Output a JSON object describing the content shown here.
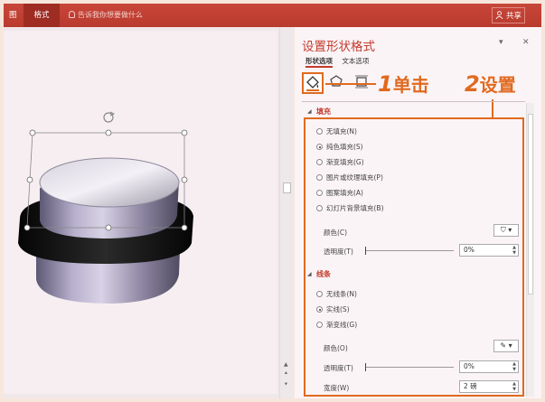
{
  "ribbon": {
    "tab_left": "图",
    "tab_active": "格式",
    "tell_me": "告诉我你想要做什么",
    "share": "共享"
  },
  "pane": {
    "title": "设置形状格式",
    "ctl_dropdown": "▾",
    "ctl_close": "✕",
    "tabs": [
      "形状选项",
      "文本选项"
    ],
    "fill": {
      "header": "填充",
      "options": [
        "无填充(N)",
        "纯色填充(S)",
        "渐变填充(G)",
        "图片或纹理填充(P)",
        "图案填充(A)",
        "幻灯片背景填充(B)"
      ],
      "selected": 1,
      "color_label": "颜色(C)",
      "transparency_label": "透明度(T)",
      "transparency_value": "0%"
    },
    "line": {
      "header": "线条",
      "options": [
        "无线条(N)",
        "实线(S)",
        "渐变线(G)"
      ],
      "selected": 1,
      "color_label": "颜色(O)",
      "transparency_label": "透明度(T)",
      "transparency_value": "0%",
      "width_label": "宽度(W)",
      "width_value": "2 磅"
    }
  },
  "callouts": {
    "one_num": "1",
    "one_text": "单击",
    "two_num": "2",
    "two_text": "设置"
  },
  "colors": {
    "ribbon": "#b93a2e",
    "accent": "#c23b2c",
    "callout": "#e06a1f"
  },
  "icons": [
    "fill-line-icon",
    "effects-icon",
    "size-properties-icon",
    "rotate-handle-icon",
    "bulb-icon",
    "user-icon"
  ]
}
